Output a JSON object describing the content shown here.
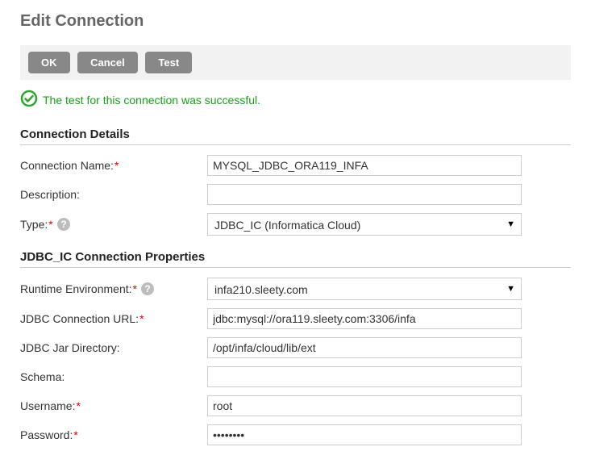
{
  "title": "Edit Connection",
  "buttons": {
    "ok": "OK",
    "cancel": "Cancel",
    "test": "Test"
  },
  "status": {
    "message": "The test for this connection was successful."
  },
  "sections": {
    "details": {
      "heading": "Connection Details",
      "fields": {
        "connection_name": {
          "label": "Connection Name:",
          "value": "MYSQL_JDBC_ORA119_INFA",
          "required": true
        },
        "description": {
          "label": "Description:",
          "value": "",
          "required": false
        },
        "type": {
          "label": "Type:",
          "value": "JDBC_IC (Informatica Cloud)",
          "required": true
        }
      }
    },
    "jdbc": {
      "heading": "JDBC_IC Connection Properties",
      "fields": {
        "runtime_env": {
          "label": "Runtime Environment:",
          "value": "infa210.sleety.com",
          "required": true
        },
        "jdbc_url": {
          "label": "JDBC Connection URL:",
          "value": "jdbc:mysql://ora119.sleety.com:3306/infa",
          "required": true
        },
        "jar_dir": {
          "label": "JDBC Jar Directory:",
          "value": "/opt/infa/cloud/lib/ext",
          "required": false
        },
        "schema": {
          "label": "Schema:",
          "value": "",
          "required": false
        },
        "username": {
          "label": "Username:",
          "value": "root",
          "required": true
        },
        "password": {
          "label": "Password:",
          "value": "••••••••",
          "required": true
        }
      }
    }
  }
}
